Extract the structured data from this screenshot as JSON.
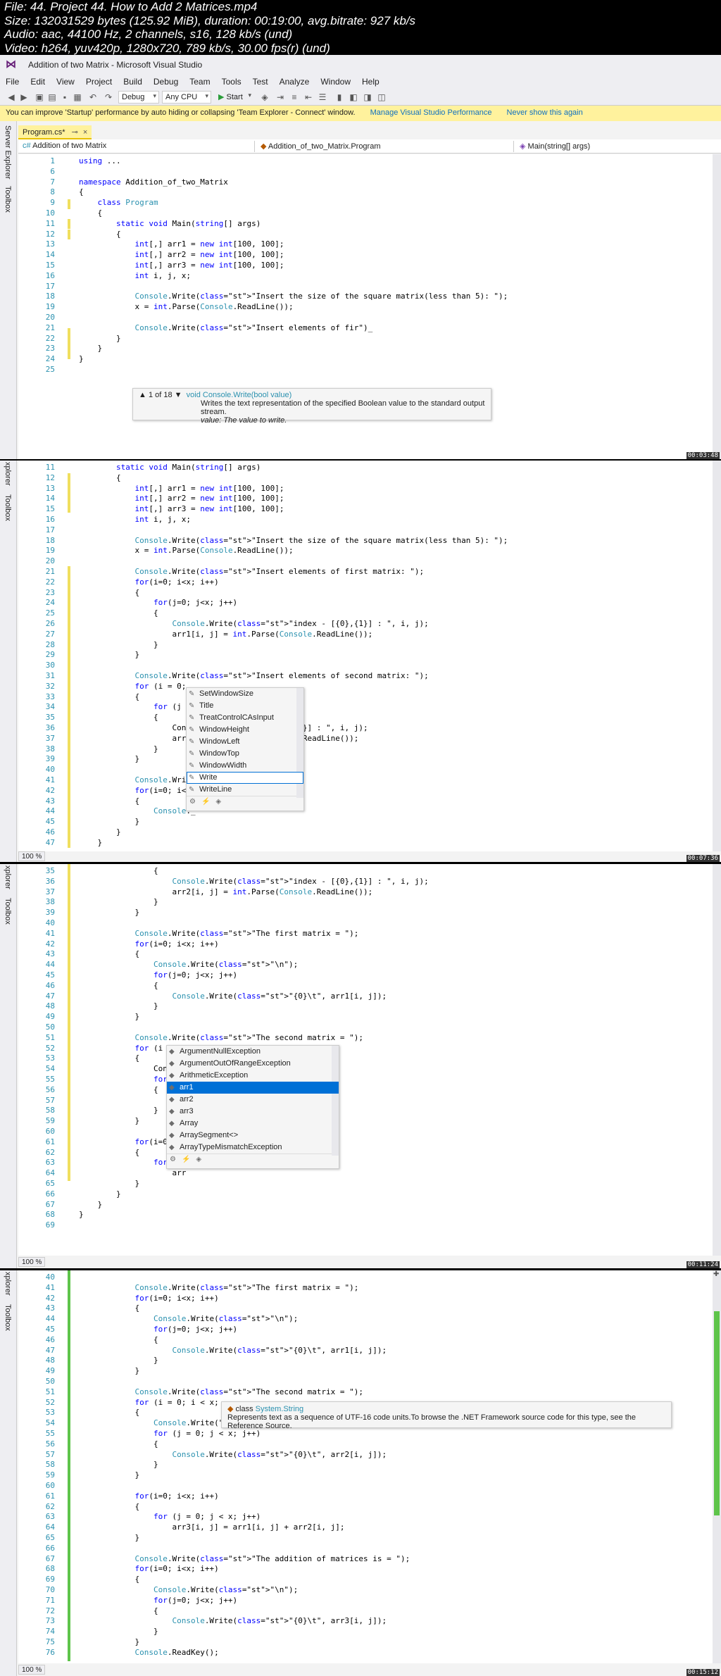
{
  "meta": {
    "file": "File: 44. Project 44. How to Add 2 Matrices.mp4",
    "size": "Size: 132031529 bytes (125.92 MiB), duration: 00:19:00, avg.bitrate: 927 kb/s",
    "audio": "Audio: aac, 44100 Hz, 2 channels, s16, 128 kb/s (und)",
    "video": "Video: h264, yuv420p, 1280x720, 789 kb/s, 30.00 fps(r) (und)"
  },
  "ide": {
    "title": "Addition of two Matrix - Microsoft Visual Studio",
    "menu": [
      "File",
      "Edit",
      "View",
      "Project",
      "Build",
      "Debug",
      "Team",
      "Tools",
      "Test",
      "Analyze",
      "Window",
      "Help"
    ],
    "config": "Debug",
    "platform": "Any CPU",
    "start": "Start",
    "infobar": {
      "message": "You can improve 'Startup' performance by auto hiding or collapsing 'Team Explorer - Connect' window.",
      "link1": "Manage Visual Studio Performance",
      "link2": "Never show this again"
    },
    "side_labels": [
      "Server Explorer",
      "Toolbox"
    ],
    "side_labels_short": [
      "xplorer",
      "Toolbox"
    ],
    "tab": "Program.cs*",
    "nav": [
      "Addition of two Matrix",
      "Addition_of_two_Matrix.Program",
      "Main(string[] args)"
    ],
    "zoom": "100 %"
  },
  "timestamps": [
    "00:03:48",
    "00:07:36",
    "00:11:24",
    "00:15:12"
  ],
  "pane1": {
    "lines": [
      {
        "n": "1",
        "t": "using ..."
      },
      {
        "n": "6",
        "t": ""
      },
      {
        "n": "7",
        "t": "namespace Addition_of_two_Matrix"
      },
      {
        "n": "8",
        "t": "{"
      },
      {
        "n": "9",
        "t": "    class Program"
      },
      {
        "n": "10",
        "t": "    {"
      },
      {
        "n": "11",
        "t": "        static void Main(string[] args)"
      },
      {
        "n": "12",
        "t": "        {"
      },
      {
        "n": "13",
        "t": "            int[,] arr1 = new int[100, 100];"
      },
      {
        "n": "14",
        "t": "            int[,] arr2 = new int[100, 100];"
      },
      {
        "n": "15",
        "t": "            int[,] arr3 = new int[100, 100];"
      },
      {
        "n": "16",
        "t": "            int i, j, x;"
      },
      {
        "n": "17",
        "t": ""
      },
      {
        "n": "18",
        "t": "            Console.Write(\"Insert the size of the square matrix(less than 5): \");"
      },
      {
        "n": "19",
        "t": "            x = int.Parse(Console.ReadLine());"
      },
      {
        "n": "20",
        "t": ""
      },
      {
        "n": "21",
        "t": "            Console.Write(\"Insert elements of fir\")_"
      },
      {
        "n": "22",
        "t": "        }"
      },
      {
        "n": "23",
        "t": "    }"
      },
      {
        "n": "24",
        "t": "}"
      },
      {
        "n": "25",
        "t": ""
      }
    ],
    "tooltip": {
      "counter": "▲ 1 of 18 ▼",
      "signature": "void Console.Write(bool value)",
      "desc": "Writes the text representation of the specified Boolean value to the standard output stream.",
      "param": "value: The value to write."
    }
  },
  "pane2": {
    "lines": [
      {
        "n": "11",
        "t": "        static void Main(string[] args)"
      },
      {
        "n": "12",
        "t": "        {"
      },
      {
        "n": "13",
        "t": "            int[,] arr1 = new int[100, 100];"
      },
      {
        "n": "14",
        "t": "            int[,] arr2 = new int[100, 100];"
      },
      {
        "n": "15",
        "t": "            int[,] arr3 = new int[100, 100];"
      },
      {
        "n": "16",
        "t": "            int i, j, x;"
      },
      {
        "n": "17",
        "t": ""
      },
      {
        "n": "18",
        "t": "            Console.Write(\"Insert the size of the square matrix(less than 5): \");"
      },
      {
        "n": "19",
        "t": "            x = int.Parse(Console.ReadLine());"
      },
      {
        "n": "20",
        "t": ""
      },
      {
        "n": "21",
        "t": "            Console.Write(\"Insert elements of first matrix: \");"
      },
      {
        "n": "22",
        "t": "            for(i=0; i<x; i++)"
      },
      {
        "n": "23",
        "t": "            {"
      },
      {
        "n": "24",
        "t": "                for(j=0; j<x; j++)"
      },
      {
        "n": "25",
        "t": "                {"
      },
      {
        "n": "26",
        "t": "                    Console.Write(\"index - [{0},{1}] : \", i, j);"
      },
      {
        "n": "27",
        "t": "                    arr1[i, j] = int.Parse(Console.ReadLine());"
      },
      {
        "n": "28",
        "t": "                }"
      },
      {
        "n": "29",
        "t": "            }"
      },
      {
        "n": "30",
        "t": ""
      },
      {
        "n": "31",
        "t": "            Console.Write(\"Insert elements of second matrix: \");"
      },
      {
        "n": "32",
        "t": "            for (i = 0;"
      },
      {
        "n": "33",
        "t": "            {"
      },
      {
        "n": "34",
        "t": "                for (j ="
      },
      {
        "n": "35",
        "t": "                {"
      },
      {
        "n": "36",
        "t": "                    Conso                       }] : \", i, j);"
      },
      {
        "n": "37",
        "t": "                    arr2                       .ReadLine());"
      },
      {
        "n": "38",
        "t": "                }"
      },
      {
        "n": "39",
        "t": "            }"
      },
      {
        "n": "40",
        "t": ""
      },
      {
        "n": "41",
        "t": "            Console.Writ"
      },
      {
        "n": "42",
        "t": "            for(i=0; i<x"
      },
      {
        "n": "43",
        "t": "            {"
      },
      {
        "n": "44",
        "t": "                Console._"
      },
      {
        "n": "45",
        "t": "            }"
      },
      {
        "n": "46",
        "t": "        }"
      },
      {
        "n": "47",
        "t": "    }"
      }
    ],
    "autocomplete": [
      "SetWindowSize",
      "Title",
      "TreatControlCAsInput",
      "WindowHeight",
      "WindowLeft",
      "WindowTop",
      "WindowWidth",
      "Write",
      "WriteLine"
    ]
  },
  "pane3": {
    "lines": [
      {
        "n": "35",
        "t": "                {"
      },
      {
        "n": "36",
        "t": "                    Console.Write(\"index - [{0},{1}] : \", i, j);"
      },
      {
        "n": "37",
        "t": "                    arr2[i, j] = int.Parse(Console.ReadLine());"
      },
      {
        "n": "38",
        "t": "                }"
      },
      {
        "n": "39",
        "t": "            }"
      },
      {
        "n": "40",
        "t": ""
      },
      {
        "n": "41",
        "t": "            Console.Write(\"The first matrix = \");"
      },
      {
        "n": "42",
        "t": "            for(i=0; i<x; i++)"
      },
      {
        "n": "43",
        "t": "            {"
      },
      {
        "n": "44",
        "t": "                Console.Write(\"\\n\");"
      },
      {
        "n": "45",
        "t": "                for(j=0; j<x; j++)"
      },
      {
        "n": "46",
        "t": "                {"
      },
      {
        "n": "47",
        "t": "                    Console.Write(\"{0}\\t\", arr1[i, j]);"
      },
      {
        "n": "48",
        "t": "                }"
      },
      {
        "n": "49",
        "t": "            }"
      },
      {
        "n": "50",
        "t": ""
      },
      {
        "n": "51",
        "t": "            Console.Write(\"The second matrix = \");"
      },
      {
        "n": "52",
        "t": "            for (i ="
      },
      {
        "n": "53",
        "t": "            {"
      },
      {
        "n": "54",
        "t": "                Conso"
      },
      {
        "n": "55",
        "t": "                for"
      },
      {
        "n": "56",
        "t": "                {"
      },
      {
        "n": "57",
        "t": ""
      },
      {
        "n": "58",
        "t": "                }"
      },
      {
        "n": "59",
        "t": "            }"
      },
      {
        "n": "60",
        "t": ""
      },
      {
        "n": "61",
        "t": "            for(i=0;"
      },
      {
        "n": "62",
        "t": "            {"
      },
      {
        "n": "63",
        "t": "                for("
      },
      {
        "n": "64",
        "t": "                    arr"
      },
      {
        "n": "65",
        "t": "            }"
      },
      {
        "n": "66",
        "t": "        }"
      },
      {
        "n": "67",
        "t": "    }"
      },
      {
        "n": "68",
        "t": "}"
      },
      {
        "n": "69",
        "t": ""
      }
    ],
    "autocomplete": [
      "ArgumentNullException",
      "ArgumentOutOfRangeException",
      "ArithmeticException",
      "arr1",
      "arr2",
      "arr3",
      "Array",
      "ArraySegment<>",
      "ArrayTypeMismatchException"
    ]
  },
  "pane4": {
    "lines": [
      {
        "n": "40",
        "t": ""
      },
      {
        "n": "41",
        "t": "            Console.Write(\"The first matrix = \");"
      },
      {
        "n": "42",
        "t": "            for(i=0; i<x; i++)"
      },
      {
        "n": "43",
        "t": "            {"
      },
      {
        "n": "44",
        "t": "                Console.Write(\"\\n\");"
      },
      {
        "n": "45",
        "t": "                for(j=0; j<x; j++)"
      },
      {
        "n": "46",
        "t": "                {"
      },
      {
        "n": "47",
        "t": "                    Console.Write(\"{0}\\t\", arr1[i, j]);"
      },
      {
        "n": "48",
        "t": "                }"
      },
      {
        "n": "49",
        "t": "            }"
      },
      {
        "n": "50",
        "t": ""
      },
      {
        "n": "51",
        "t": "            Console.Write(\"The second matrix = \");"
      },
      {
        "n": "52",
        "t": "            for (i = 0; i < x;"
      },
      {
        "n": "53",
        "t": "            {"
      },
      {
        "n": "54",
        "t": "                Console.Write(\""
      },
      {
        "n": "55",
        "t": "                for (j = 0; j < x; j++)"
      },
      {
        "n": "56",
        "t": "                {"
      },
      {
        "n": "57",
        "t": "                    Console.Write(\"{0}\\t\", arr2[i, j]);"
      },
      {
        "n": "58",
        "t": "                }"
      },
      {
        "n": "59",
        "t": "            }"
      },
      {
        "n": "60",
        "t": ""
      },
      {
        "n": "61",
        "t": "            for(i=0; i<x; i++)"
      },
      {
        "n": "62",
        "t": "            {"
      },
      {
        "n": "63",
        "t": "                for (j = 0; j < x; j++)"
      },
      {
        "n": "64",
        "t": "                    arr3[i, j] = arr1[i, j] + arr2[i, j];"
      },
      {
        "n": "65",
        "t": "            }"
      },
      {
        "n": "66",
        "t": ""
      },
      {
        "n": "67",
        "t": "            Console.Write(\"The addition of matrices is = \");"
      },
      {
        "n": "68",
        "t": "            for(i=0; i<x; i++)"
      },
      {
        "n": "69",
        "t": "            {"
      },
      {
        "n": "70",
        "t": "                Console.Write(\"\\n\");"
      },
      {
        "n": "71",
        "t": "                for(j=0; j<x; j++)"
      },
      {
        "n": "72",
        "t": "                {"
      },
      {
        "n": "73",
        "t": "                    Console.Write(\"{0}\\t\", arr3[i, j]);"
      },
      {
        "n": "74",
        "t": "                }"
      },
      {
        "n": "75",
        "t": "            }"
      },
      {
        "n": "76",
        "t": "            Console.ReadKey();"
      }
    ],
    "tooltip": {
      "kind": "class",
      "name": "System.String",
      "desc": "Represents text as a sequence of UTF-16 code units.To browse the .NET Framework source code for this type, see the Reference Source."
    }
  }
}
